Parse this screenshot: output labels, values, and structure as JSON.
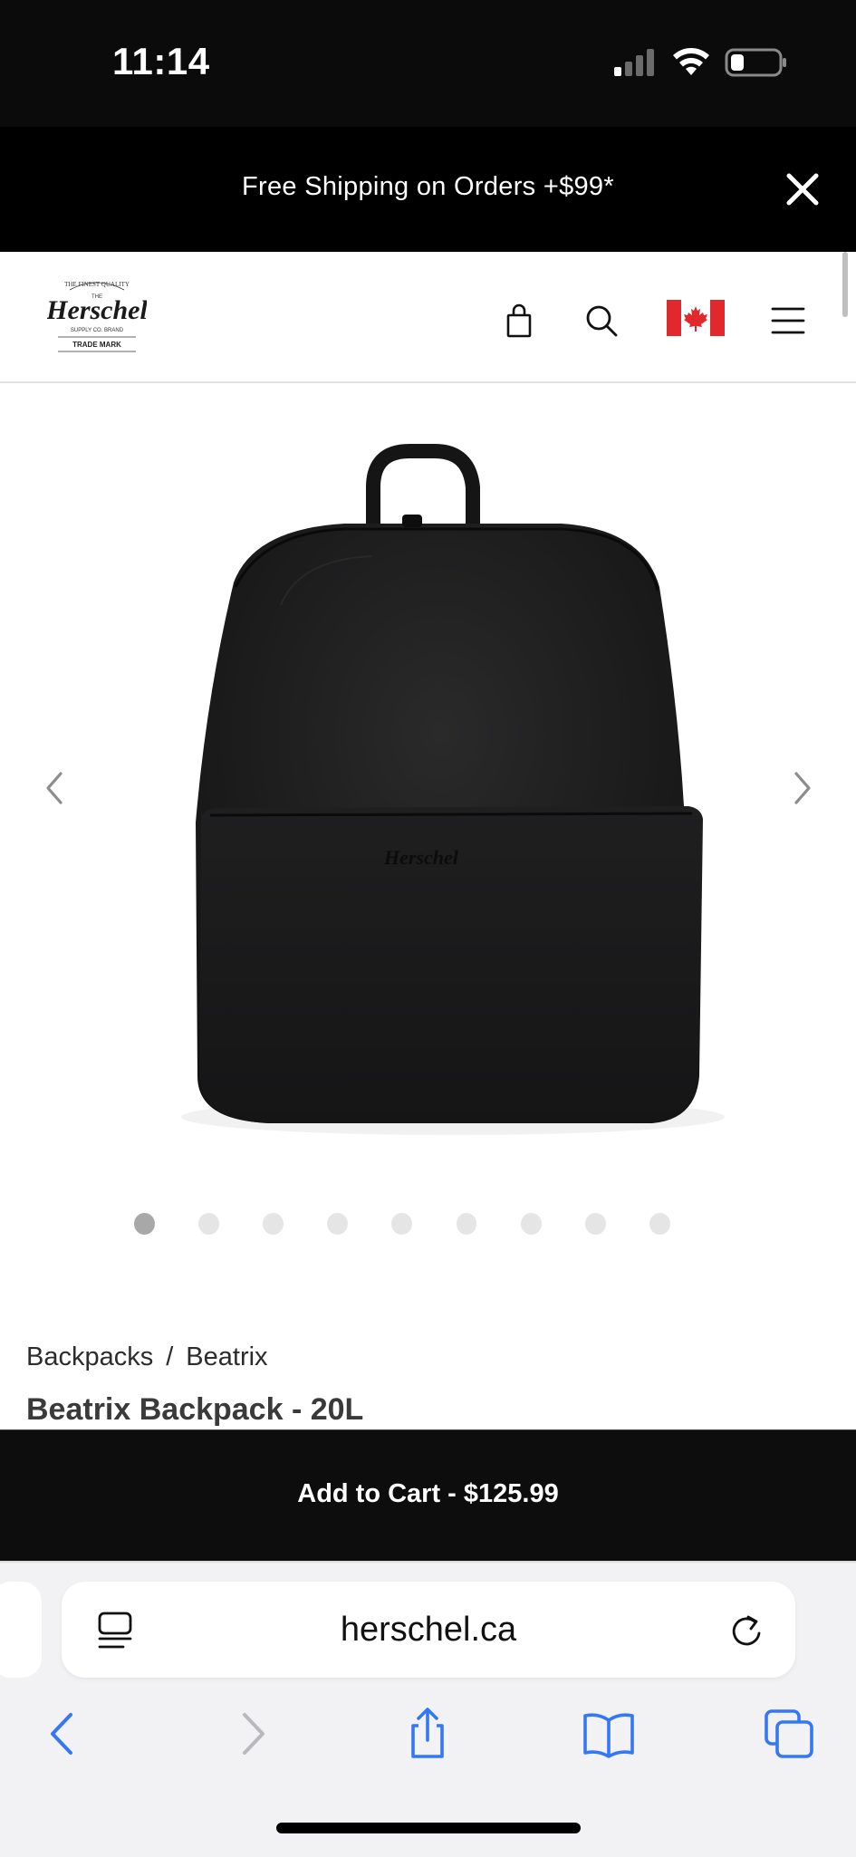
{
  "status": {
    "time": "11:14",
    "signal_icon": "cellular-signal-icon",
    "wifi_icon": "wifi-icon",
    "battery_icon": "battery-icon"
  },
  "promo": {
    "text": "Free Shipping on Orders +$99*",
    "close_icon": "close-icon"
  },
  "header": {
    "logo_lines": [
      "THE FINEST QUALITY",
      "THE",
      "Herschel",
      "SUPPLY CO. BRAND",
      "TRADE MARK"
    ],
    "icons": [
      "shopping-bag-icon",
      "search-icon",
      "canada-flag-icon",
      "hamburger-menu-icon"
    ]
  },
  "gallery": {
    "image": "black-backpack-image",
    "image_brand": "Herschel",
    "slide_count": 9,
    "active_slide": 1,
    "prev_icon": "chevron-left-icon",
    "next_icon": "chevron-right-icon"
  },
  "product": {
    "breadcrumb": [
      "Backpacks",
      "Beatrix"
    ],
    "breadcrumb_separator": "/",
    "title": "Beatrix Backpack - 20L"
  },
  "cart": {
    "label": "Add to Cart - $125.99"
  },
  "browser": {
    "url": "herschel.ca",
    "reader_icon": "reader-mode-icon",
    "reload_icon": "reload-icon",
    "toolbar": [
      "back-icon",
      "forward-icon",
      "share-icon",
      "bookmarks-icon",
      "tabs-icon"
    ]
  },
  "colors": {
    "accent": "#3478f6",
    "flag_red": "#e0282d",
    "promo_bg": "#000000"
  }
}
